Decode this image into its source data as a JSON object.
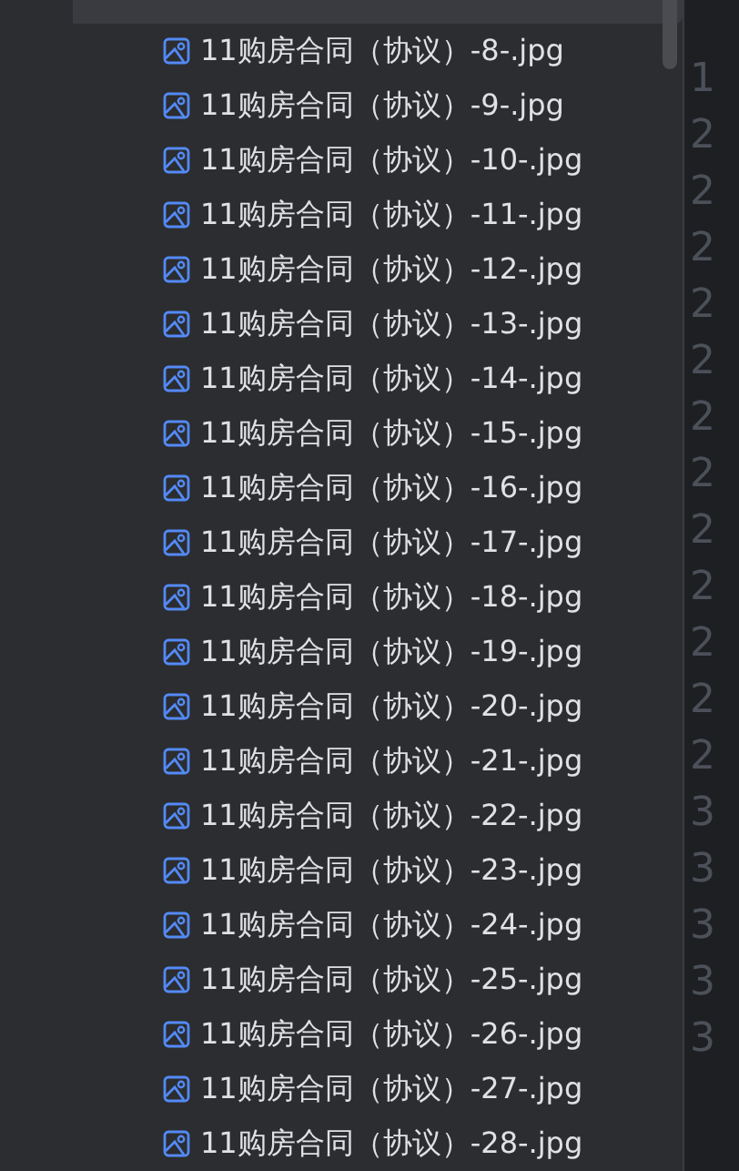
{
  "files": [
    {
      "name": "11购房合同（协议）-8-.jpg",
      "selected": false
    },
    {
      "name": "11购房合同（协议）-9-.jpg",
      "selected": false
    },
    {
      "name": "11购房合同（协议）-10-.jpg",
      "selected": false
    },
    {
      "name": "11购房合同（协议）-11-.jpg",
      "selected": false
    },
    {
      "name": "11购房合同（协议）-12-.jpg",
      "selected": false
    },
    {
      "name": "11购房合同（协议）-13-.jpg",
      "selected": false
    },
    {
      "name": "11购房合同（协议）-14-.jpg",
      "selected": false
    },
    {
      "name": "11购房合同（协议）-15-.jpg",
      "selected": false
    },
    {
      "name": "11购房合同（协议）-16-.jpg",
      "selected": false
    },
    {
      "name": "11购房合同（协议）-17-.jpg",
      "selected": false
    },
    {
      "name": "11购房合同（协议）-18-.jpg",
      "selected": false
    },
    {
      "name": "11购房合同（协议）-19-.jpg",
      "selected": false
    },
    {
      "name": "11购房合同（协议）-20-.jpg",
      "selected": false
    },
    {
      "name": "11购房合同（协议）-21-.jpg",
      "selected": false
    },
    {
      "name": "11购房合同（协议）-22-.jpg",
      "selected": false
    },
    {
      "name": "11购房合同（协议）-23-.jpg",
      "selected": false
    },
    {
      "name": "11购房合同（协议）-24-.jpg",
      "selected": false
    },
    {
      "name": "11购房合同（协议）-25-.jpg",
      "selected": false
    },
    {
      "name": "11购房合同（协议）-26-.jpg",
      "selected": false
    },
    {
      "name": "11购房合同（协议）-27-.jpg",
      "selected": false
    },
    {
      "name": "11购房合同（协议）-28-.jpg",
      "selected": false
    }
  ],
  "line_numbers": [
    "1",
    "2",
    "2",
    "2",
    "2",
    "2",
    "2",
    "2",
    "2",
    "2",
    "2",
    "2",
    "2",
    "3",
    "3",
    "3",
    "3",
    "3"
  ]
}
